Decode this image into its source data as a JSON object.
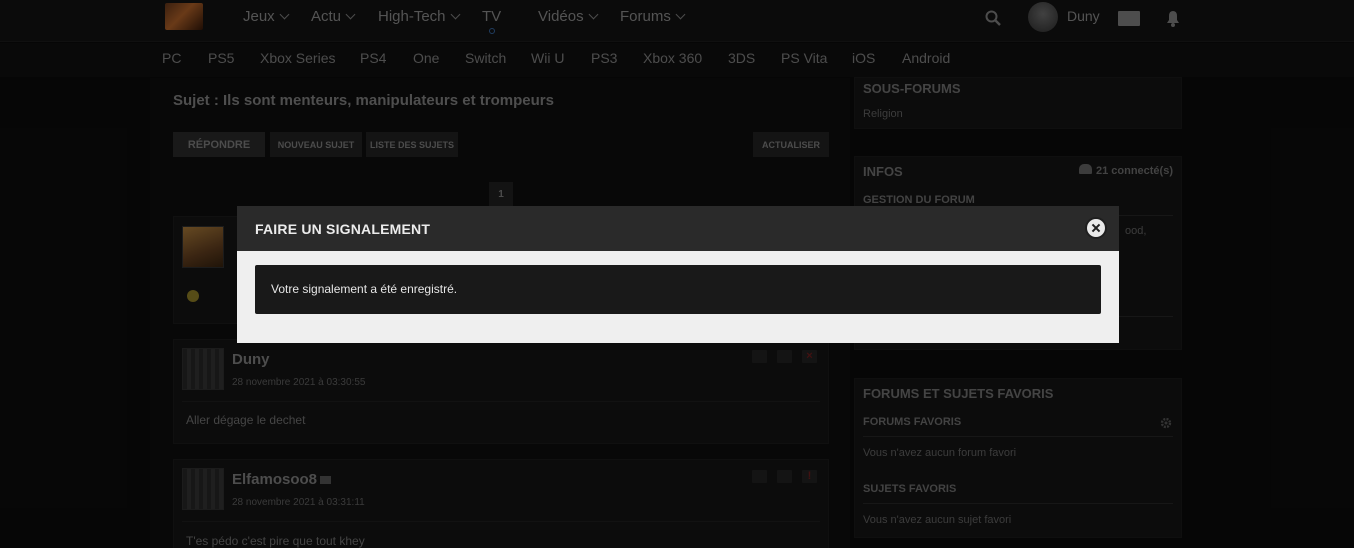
{
  "header": {
    "nav": [
      {
        "label": "Jeux",
        "dropdown": true
      },
      {
        "label": "Actu",
        "dropdown": true
      },
      {
        "label": "High-Tech",
        "dropdown": true
      },
      {
        "label": "TV",
        "dropdown": false
      },
      {
        "label": "Vidéos",
        "dropdown": true
      },
      {
        "label": "Forums",
        "dropdown": true
      }
    ],
    "username": "Duny",
    "icons": [
      "search-icon",
      "mail-icon",
      "notification-bell-icon"
    ]
  },
  "platforms": [
    "PC",
    "PS5",
    "Xbox Series",
    "PS4",
    "One",
    "Switch",
    "Wii U",
    "PS3",
    "Xbox 360",
    "3DS",
    "PS Vita",
    "iOS",
    "Android"
  ],
  "topic": {
    "title": "Sujet : Ils sont menteurs, manipulateurs et trompeurs",
    "buttons": {
      "reply": "RÉPONDRE",
      "new_topic": "NOUVEAU SUJET",
      "topic_list": "LISTE DES SUJETS",
      "refresh": "ACTUALISER"
    },
    "page": "1"
  },
  "posts": [
    {
      "author": "Duny",
      "date": "28 novembre 2021 à 03:30:55",
      "text": "Aller dégage le dechet"
    },
    {
      "author": "Elfamosoo8",
      "date": "28 novembre 2021 à 03:31:11",
      "text": "T'es pédo c'est pire que tout khey"
    }
  ],
  "sidebar": {
    "subforums": {
      "title": "SOUS-FORUMS",
      "items": [
        "Religion"
      ]
    },
    "infos": {
      "title": "INFOS",
      "connected": "21 connecté(s)",
      "management": "GESTION DU FORUM",
      "partial_text": "ood,"
    },
    "favorites": {
      "title": "FORUMS ET SUJETS FAVORIS",
      "forums_title": "FORUMS FAVORIS",
      "forums_empty": "Vous n'avez aucun forum favori",
      "topics_title": "SUJETS FAVORIS",
      "topics_empty": "Vous n'avez aucun sujet favori"
    }
  },
  "modal": {
    "title": "FAIRE UN SIGNALEMENT",
    "message": "Votre signalement a été enregistré."
  }
}
